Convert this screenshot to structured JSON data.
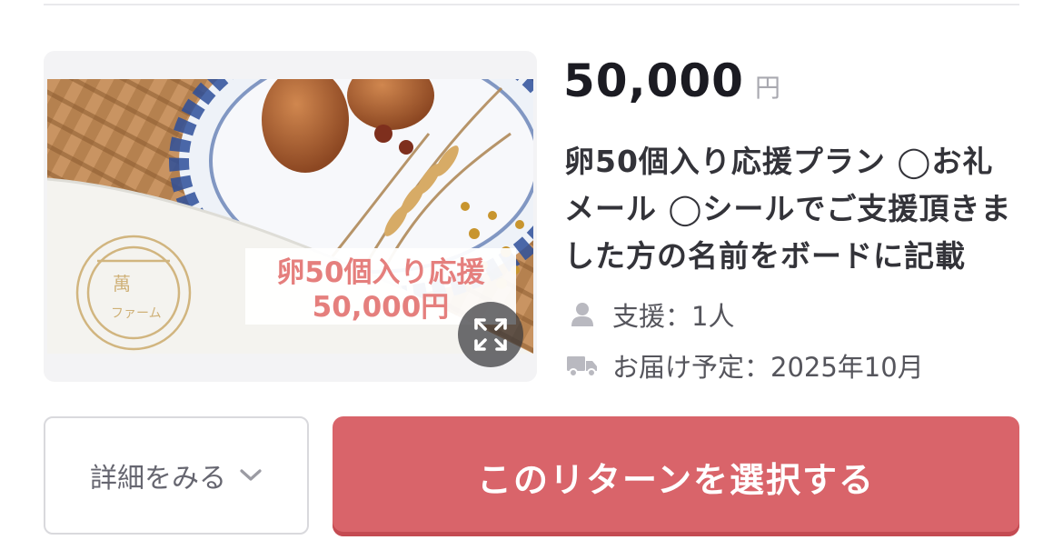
{
  "reward": {
    "price": "50,000",
    "currency": "円",
    "title": "卵50個入り応援プラン ◯お礼メール ◯シールでご支援頂きました方の名前をボードに記載",
    "supporters": "支援：1人",
    "delivery": "お届け予定：2025年10月"
  },
  "image": {
    "overlay_line1": "卵50個入り応援",
    "overlay_line2": "50,000円",
    "stamp_text": "ファーム",
    "icon": "expand-icon"
  },
  "buttons": {
    "details_label": "詳細をみる",
    "select_label": "このリターンを選択する"
  },
  "colors": {
    "accent": "#d9646a",
    "price_text": "#1b1b22",
    "muted": "#a9a9b0",
    "overlay_text": "#e57f7d"
  }
}
